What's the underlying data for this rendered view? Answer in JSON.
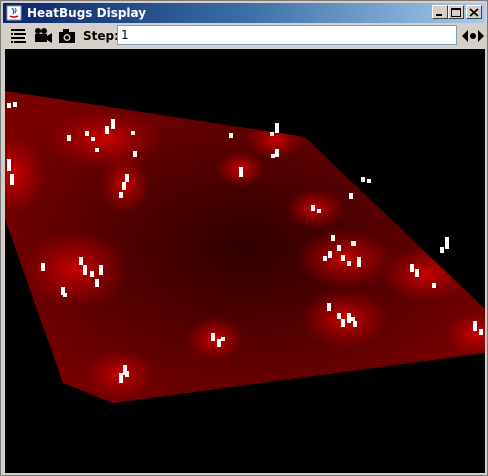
{
  "window": {
    "title": "HeatBugs Display"
  },
  "titlebar_buttons": {
    "minimize_icon": "minimize-icon",
    "maximize_icon": "maximize-icon",
    "close_icon": "close-icon"
  },
  "toolbar": {
    "layers_icon": "layers-icon",
    "movie_icon": "movie-camera-icon",
    "snapshot_icon": "camera-icon",
    "step_label": "Step:",
    "step_value": "1",
    "spinner_icon": "left-right-arrows-icon"
  },
  "colors": {
    "surface_dark": "#3a0000",
    "surface_bright": "#b00000",
    "bug": "#ffffff",
    "background": "#000000"
  }
}
